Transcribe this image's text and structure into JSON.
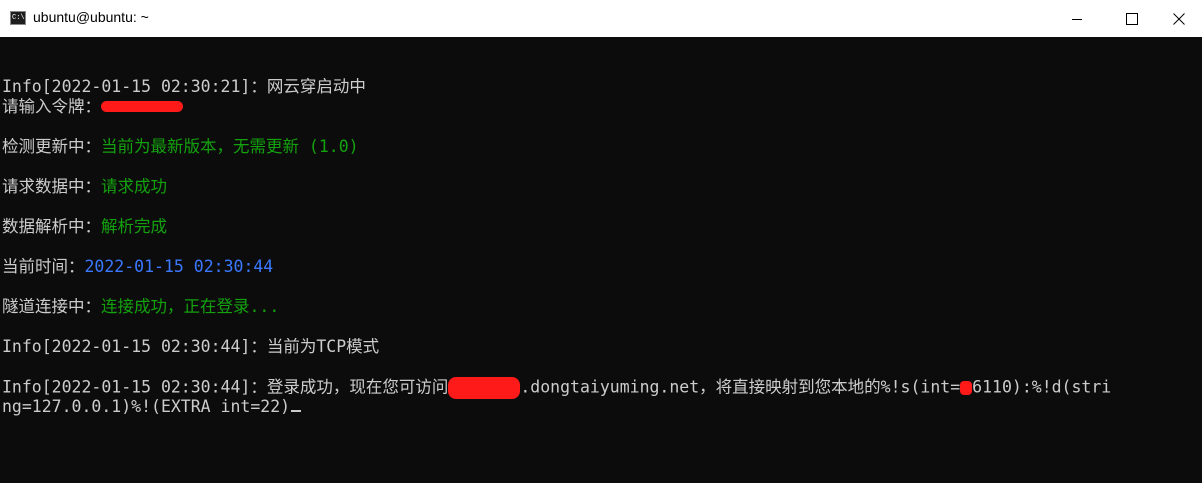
{
  "window": {
    "title": "ubuntu@ubuntu: ~",
    "icon": "console-icon",
    "icon_text": "C:\\."
  },
  "colors": {
    "background": "#0c0c0c",
    "text": "#cccccc",
    "success": "#13a10e",
    "info_time": "#3b78ff",
    "redaction": "#ff1a1a"
  },
  "terminal": {
    "line1": "Info[2022-01-15 02:30:21]：网云穿启动中",
    "token_prompt": "请输入令牌：",
    "update_label": "检测更新中：",
    "update_status": "当前为最新版本，无需更新 (1.0)",
    "request_label": "请求数据中：",
    "request_status": "请求成功",
    "parse_label": "数据解析中：",
    "parse_status": "解析完成",
    "time_label": "当前时间：",
    "time_value": "2022-01-15 02:30:44",
    "tunnel_label": "隧道连接中：",
    "tunnel_status": "连接成功，正在登录...",
    "mode_line": "Info[2022-01-15 02:30:44]：当前为TCP模式",
    "login_prefix": "Info[2022-01-15 02:30:44]：登录成功，现在您可访问",
    "login_domain": ".dongtaiyuming.net，将直接映射到您本地的%!s(int=",
    "login_port": "6110",
    "login_suffix": "):%!d(stri",
    "login_wrap": "ng=127.0.0.1)%!(EXTRA int=22)"
  }
}
